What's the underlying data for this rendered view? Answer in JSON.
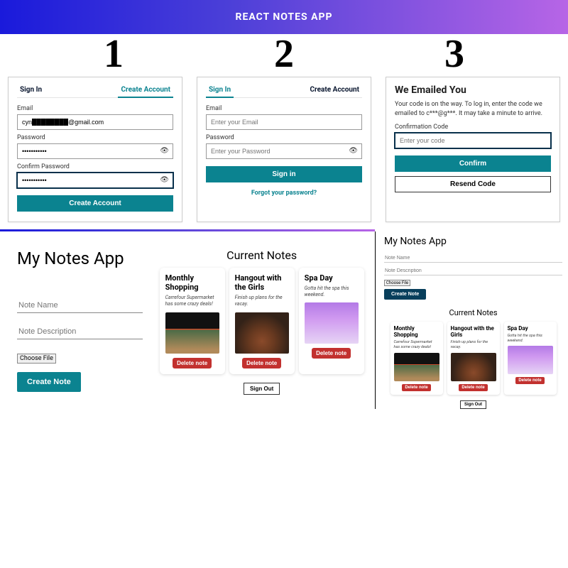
{
  "header": {
    "title": "REACT NOTES APP"
  },
  "steps": [
    "1",
    "2",
    "3"
  ],
  "card1": {
    "tabs": {
      "signin": "Sign In",
      "create": "Create Account"
    },
    "email_label": "Email",
    "email_value": "cyn████████@gmail.com",
    "password_label": "Password",
    "password_value": "•••••••••••",
    "confirm_label": "Confirm Password",
    "confirm_value": "•••••••••••",
    "submit": "Create Account"
  },
  "card2": {
    "tabs": {
      "signin": "Sign In",
      "create": "Create Account"
    },
    "email_label": "Email",
    "email_placeholder": "Enter your Email",
    "password_label": "Password",
    "password_placeholder": "Enter your Password",
    "submit": "Sign in",
    "forgot": "Forgot your password?"
  },
  "card3": {
    "title": "We Emailed You",
    "subtitle": "Your code is on the way. To log in, enter the code we emailed to c***@g***. It may take a minute to arrive.",
    "code_label": "Confirmation Code",
    "code_placeholder": "Enter your code",
    "confirm": "Confirm",
    "resend": "Resend Code"
  },
  "app_left": {
    "title": "My Notes App",
    "name_placeholder": "Note Name",
    "desc_placeholder": "Note Description",
    "choose_file": "Choose File",
    "create_btn": "Create Note",
    "current_notes": "Current Notes",
    "signout": "Sign Out",
    "notes": [
      {
        "title": "Monthly Shopping",
        "desc": "Carrefour Supermarket has some crazy deals!",
        "delete": "Delete note",
        "img": "img1"
      },
      {
        "title": "Hangout with the Girls",
        "desc": "Finish up plans for the vacay.",
        "delete": "Delete note",
        "img": "img2"
      },
      {
        "title": "Spa Day",
        "desc": "Gotta hit the spa this weekend.",
        "delete": "Delete note",
        "img": "img3"
      }
    ]
  },
  "app_right": {
    "title": "My Notes App",
    "name_placeholder": "Note Name",
    "desc_placeholder": "Note Description",
    "choose_file": "Choose File",
    "create_btn": "Create Note",
    "current_notes": "Current Notes",
    "signout": "Sign Out",
    "notes": [
      {
        "title": "Monthly Shopping",
        "desc": "Carrefour Supermarket has some crazy deals!",
        "delete": "Delete note",
        "img": "img1"
      },
      {
        "title": "Hangout with the Girls",
        "desc": "Finish up plans for the vacay.",
        "delete": "Delete note",
        "img": "img2"
      },
      {
        "title": "Spa Day",
        "desc": "Gotta hit the spa this weekend.",
        "delete": "Delete note",
        "img": "img3"
      }
    ]
  }
}
